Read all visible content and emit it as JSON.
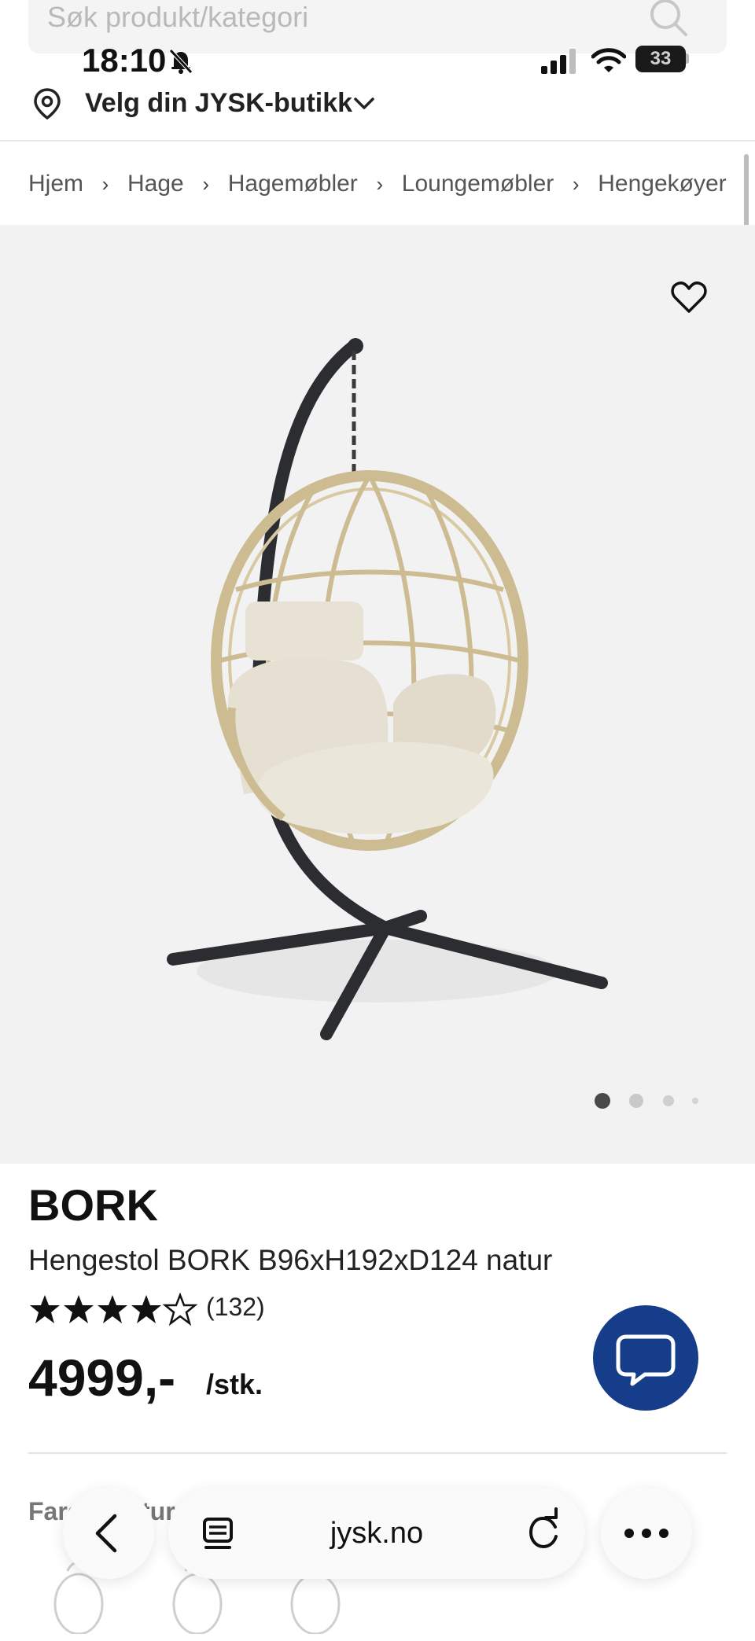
{
  "search": {
    "placeholder": "Søk produkt/kategori",
    "icon": "search-icon"
  },
  "status_bar": {
    "time": "18:10",
    "battery": "33",
    "icons": [
      "bell-slash-icon",
      "signal-icon",
      "wifi-icon",
      "battery-icon"
    ]
  },
  "store": {
    "label": "Velg din JYSK-butikk",
    "icon": "location-pin-icon"
  },
  "breadcrumb": [
    "Hjem",
    "Hage",
    "Hagemøbler",
    "Loungemøbler",
    "Hengekøyer og hengestoler"
  ],
  "gallery": {
    "active_index": 0,
    "dot_count": 4,
    "favorite_icon": "heart-icon"
  },
  "product": {
    "brand": "BORK",
    "title": "Hengestol BORK B96xH192xD124 natur",
    "rating": 4.5,
    "reviews": "(132)",
    "price": "4999,-",
    "unit": "/stk.",
    "color_label": "Farge: natur"
  },
  "chat": {
    "icon": "chat-bubble-icon"
  },
  "browser": {
    "url": "jysk.no",
    "icons": [
      "chevron-left-icon",
      "tabs-icon",
      "reload-icon",
      "more-icon"
    ]
  },
  "colors": {
    "brand_blue": "#153d8a",
    "image_bg": "#f2f2f2"
  }
}
